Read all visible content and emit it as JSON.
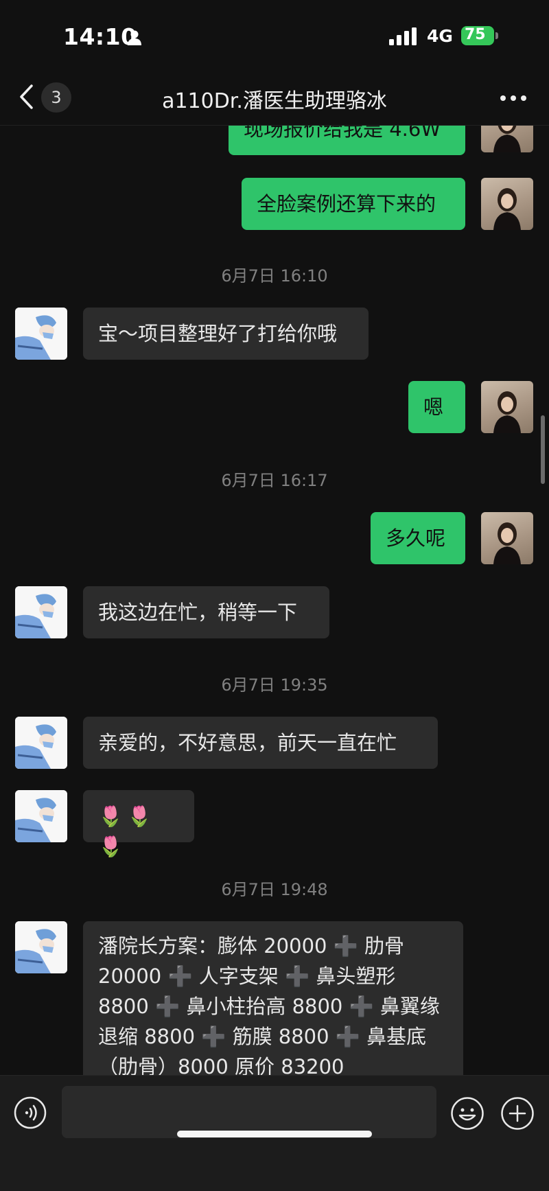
{
  "status_bar": {
    "time": "14:10",
    "network": "4G",
    "battery": "75"
  },
  "nav": {
    "unread_count": "3",
    "title": "a110Dr.潘医生助理骆冰"
  },
  "messages": [
    {
      "type": "out",
      "text": "现场报价给我是 4.6W"
    },
    {
      "type": "out",
      "text": "全脸案例还算下来的"
    },
    {
      "type": "time",
      "text": "6月7日 16:10"
    },
    {
      "type": "in",
      "text": "宝～项目整理好了打给你哦"
    },
    {
      "type": "out",
      "text": "嗯"
    },
    {
      "type": "time",
      "text": "6月7日 16:17"
    },
    {
      "type": "out",
      "text": "多久呢"
    },
    {
      "type": "in",
      "text": "我这边在忙，稍等一下"
    },
    {
      "type": "time",
      "text": "6月7日 19:35"
    },
    {
      "type": "in",
      "text": "亲爱的，不好意思，前天一直在忙"
    },
    {
      "type": "in",
      "text": "🌷🌷🌷"
    },
    {
      "type": "time",
      "text": "6月7日 19:48"
    },
    {
      "type": "in",
      "lines": [
        "潘院长方案：膨体 20000 ➕ 肋骨",
        "20000 ➕ 人字支架 ➕ 鼻头塑形",
        "8800 ➕ 鼻小柱抬高 8800 ➕ 鼻翼缘",
        "退缩 8800 ➕ 筋膜 8800 ➕ 鼻基底",
        "（肋骨）8000 原价 83200"
      ]
    }
  ],
  "icons": {
    "status": [
      "person-icon",
      "signal-icon",
      "battery-icon"
    ],
    "nav": [
      "back-chevron-icon",
      "more-icon"
    ],
    "input": [
      "voice-icon",
      "emoji-icon",
      "plus-icon"
    ]
  },
  "colors": {
    "background": "#111111",
    "outgoing_bubble": "#2fc46a",
    "incoming_bubble": "#2c2c2c",
    "timestamp": "#808080",
    "battery": "#35c759"
  }
}
